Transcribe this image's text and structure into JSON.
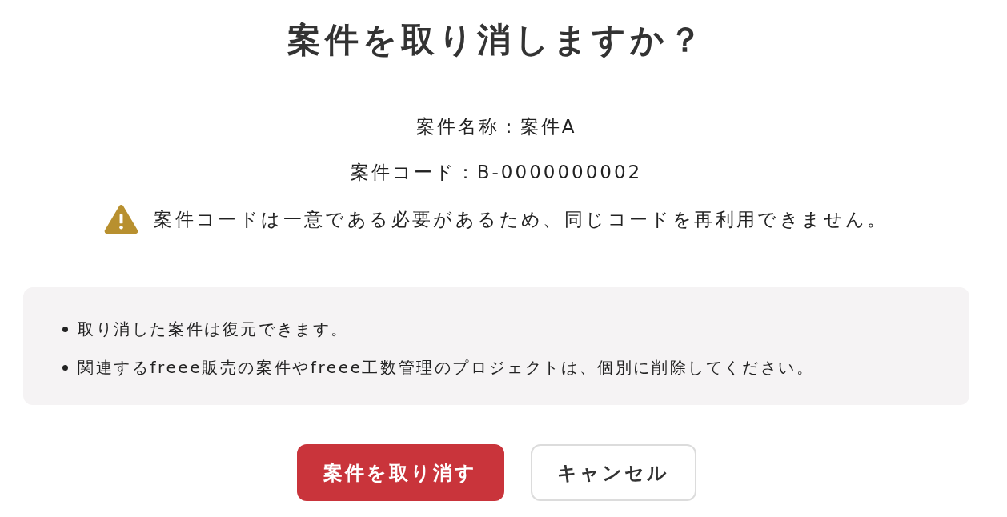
{
  "dialog": {
    "title": "案件を取り消しますか？",
    "details": [
      "案件名称：案件A",
      "案件コード：B-0000000002"
    ],
    "warning": {
      "text": "案件コードは一意である必要があるため、同じコードを再利用できません。"
    },
    "notes": [
      "取り消した案件は復元できます。",
      "関連するfreee販売の案件やfreee工数管理のプロジェクトは、個別に削除してください。"
    ],
    "buttons": [
      {
        "label": "案件を取り消す",
        "kind": "danger"
      },
      {
        "label": "キャンセル",
        "kind": "secondary"
      }
    ]
  }
}
